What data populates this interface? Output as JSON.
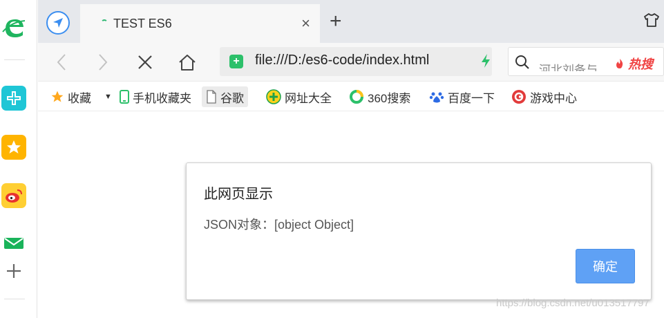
{
  "sidebar": {
    "items": [
      {
        "icon": "browser-logo-icon"
      },
      {
        "icon": "app-plus-icon",
        "color": "#1fc6d6"
      },
      {
        "icon": "star-icon",
        "color": "#ffb400"
      },
      {
        "icon": "weibo-icon",
        "color": "#f39200"
      },
      {
        "icon": "mail-icon",
        "color": "#1ab35a"
      },
      {
        "icon": "add-icon"
      }
    ]
  },
  "tab": {
    "title": "TEST ES6",
    "close_icon": "×"
  },
  "new_tab_icon": "+",
  "toolbar": {
    "url": "file:///D:/es6-code/index.html",
    "search_placeholder": "河北刘备与",
    "hot_label": "热搜"
  },
  "bookmarks": {
    "items": [
      {
        "label": "收藏",
        "icon": "star-icon"
      },
      {
        "label": "手机收藏夹",
        "icon": "phone-icon"
      },
      {
        "label": "谷歌",
        "icon": "page-icon"
      },
      {
        "label": "网址大全",
        "icon": "site-icon"
      },
      {
        "label": "360搜索",
        "icon": "search360-icon"
      },
      {
        "label": "百度一下",
        "icon": "baidu-icon"
      },
      {
        "label": "游戏中心",
        "icon": "game-icon"
      }
    ]
  },
  "dialog": {
    "title": "此网页显示",
    "message": "JSON对象：[object Object]",
    "ok_label": "确定"
  },
  "watermark": "https://blog.csdn.net/u013517797",
  "colors": {
    "accent": "#5fa1f5",
    "secure": "#2cc06a",
    "hot": "#f04343"
  }
}
